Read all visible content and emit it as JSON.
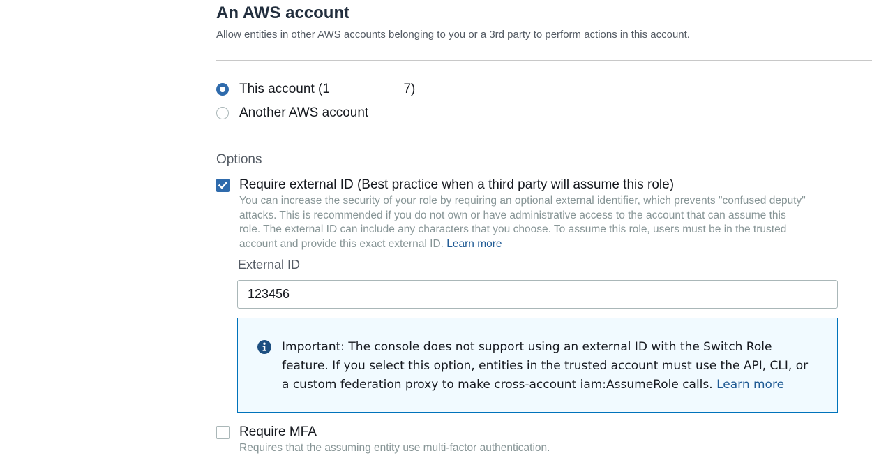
{
  "section": {
    "title": "An AWS account",
    "description": "Allow entities in other AWS accounts belonging to you or a 3rd party to perform actions in this account."
  },
  "account_choice": {
    "this_account_label": "This account (1                    7)",
    "this_account_selected": true,
    "another_account_label": "Another AWS account",
    "another_account_selected": false
  },
  "options": {
    "title": "Options",
    "external_id": {
      "checked": true,
      "label": "Require external ID (Best practice when a third party will assume this role)",
      "help_lines": [
        "You can increase the security of your role by requiring an optional external identifier, which prevents \"confused deputy\"",
        "attacks. This is recommended if you do not own or have administrative access to the account that can assume this",
        "role. The external ID can include any characters that you choose. To assume this role, users must be in the trusted",
        "account and provide this exact external ID."
      ],
      "help_link": "Learn more",
      "field_label": "External ID",
      "field_value": "123456"
    },
    "notice": {
      "icon": "info-icon",
      "lines": [
        "Important: The console does not support using an external ID with the Switch Role",
        "feature. If you select this option, entities in the trusted account must use the API, CLI, or",
        "a custom federation proxy to make cross-account iam:AssumeRole calls."
      ],
      "link": "Learn more"
    },
    "mfa": {
      "checked": false,
      "label": "Require MFA",
      "help": "Requires that the assuming entity use multi-factor authentication."
    }
  },
  "colors": {
    "accent": "#2f6bac",
    "link": "#1f5a94",
    "info_border": "#0073bb",
    "info_background": "#f1faff"
  }
}
